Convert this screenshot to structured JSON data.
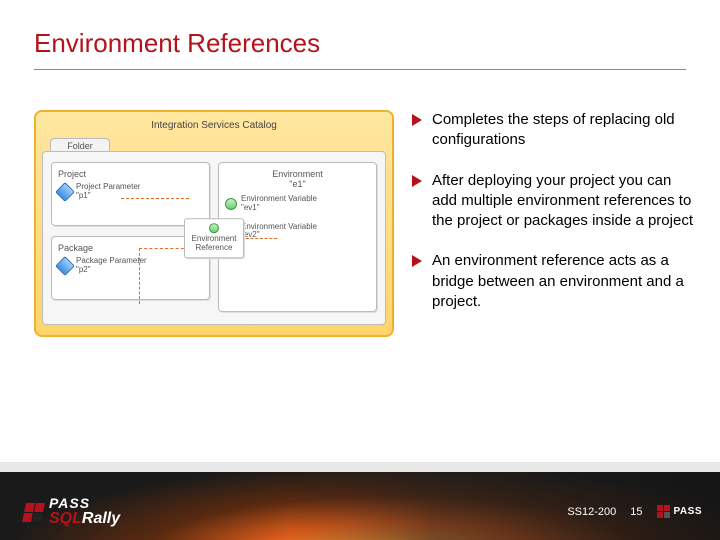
{
  "title": "Environment References",
  "bullets": [
    "Completes the steps of replacing old configurations",
    "After deploying your project you can add multiple environment references to the project or packages inside a project",
    "An environment reference acts as a bridge between an environment and a project."
  ],
  "diagram": {
    "catalog_title": "Integration Services Catalog",
    "folder_tab": "Folder",
    "project_label": "Project",
    "project_param_label": "Project Parameter",
    "project_param_name": "\"p1\"",
    "package_label": "Package",
    "package_param_label": "Package Parameter",
    "package_param_name": "\"p2\"",
    "env_label": "Environment",
    "env_name": "\"e1\"",
    "env_var_label": "Environment Variable",
    "env_var1": "\"ev1\"",
    "env_var2": "\"ev2\"",
    "env_ref_label": "Environment Reference"
  },
  "footer": {
    "brand_top": "PASS",
    "brand_sql": "SQL",
    "brand_rally": "Rally",
    "code": "SS12-200",
    "page": "15",
    "mini_brand": "PASS"
  }
}
